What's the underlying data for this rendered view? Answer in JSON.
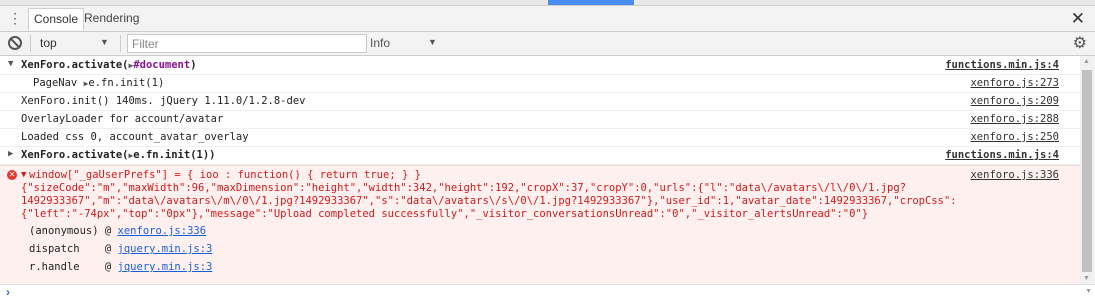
{
  "tabs": {
    "console": "Console",
    "rendering": "Rendering"
  },
  "icons": {
    "menu": "kebab-menu-icon",
    "close": "close-icon",
    "clear": "clear-console-icon",
    "settings": "gear-icon"
  },
  "toolbar": {
    "context": "top",
    "filter_placeholder": "Filter",
    "level": "Info"
  },
  "log": {
    "r1": {
      "text": "XenForo.activate(",
      "obj": "#document",
      "close": ")",
      "src": "functions.min.js:4"
    },
    "r2": {
      "label": "PageNav ",
      "value": "e.fn.init(1)",
      "src": "xenforo.js:273"
    },
    "r3": {
      "text": "XenForo.init() 140ms. jQuery 1.11.0/1.2.8-dev",
      "src": "xenforo.js:209"
    },
    "r4": {
      "text": "OverlayLoader for account/avatar",
      "src": "xenforo.js:288"
    },
    "r5": {
      "text": "Loaded css 0, account_avatar_overlay",
      "src": "xenforo.js:250"
    },
    "r6": {
      "text": "XenForo.activate(",
      "obj": "e.fn.init(1)",
      "close": ")",
      "src": "functions.min.js:4"
    },
    "err": {
      "line1": "window[\"_gaUserPrefs\"] = { ioo : function() { return true; } }",
      "line2": "{\"sizeCode\":\"m\",\"maxWidth\":96,\"maxDimension\":\"height\",\"width\":342,\"height\":192,\"cropX\":37,\"cropY\":0,\"urls\":{\"l\":\"data\\/avatars\\/l\\/0\\/1.jpg?",
      "line3": "1492933367\",\"m\":\"data\\/avatars\\/m\\/0\\/1.jpg?1492933367\",\"s\":\"data\\/avatars\\/s\\/0\\/1.jpg?1492933367\"},\"user_id\":1,\"avatar_date\":1492933367,\"cropCss\":",
      "line4": "{\"left\":\"-74px\",\"top\":\"0px\"},\"message\":\"Upload completed successfully\",\"_visitor_conversationsUnread\":\"0\",\"_visitor_alertsUnread\":\"0\"}",
      "src": "xenforo.js:336",
      "stack": [
        {
          "name": "(anonymous)",
          "at": "@ ",
          "link": "xenforo.js:336"
        },
        {
          "name": "dispatch   ",
          "at": "@ ",
          "link": "jquery.min.js:3"
        },
        {
          "name": "r.handle   ",
          "at": "@ ",
          "link": "jquery.min.js:3"
        }
      ]
    }
  }
}
